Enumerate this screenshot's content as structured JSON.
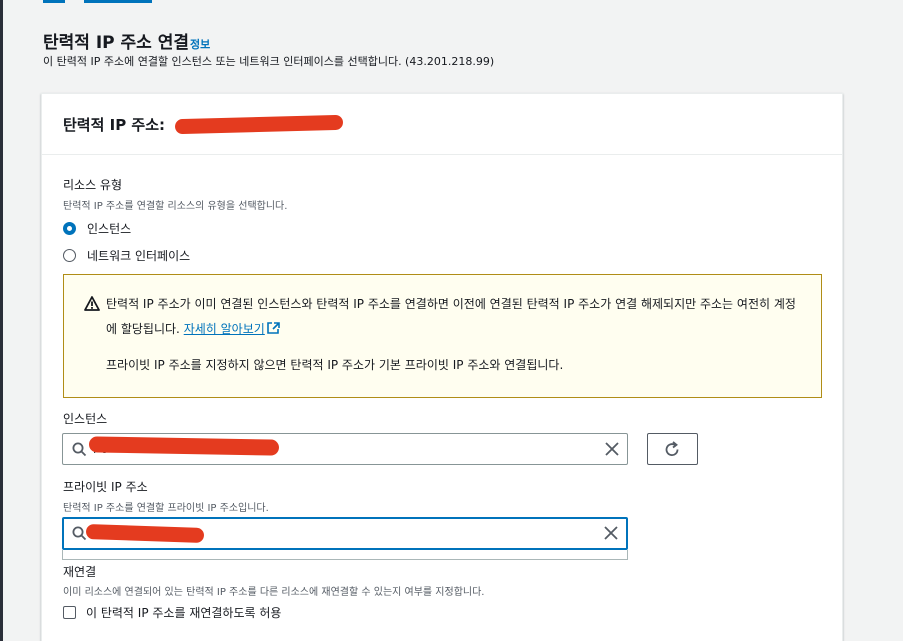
{
  "page": {
    "title": "탄력적 IP 주소 연결",
    "info_link": "정보",
    "description": "이 탄력적 IP 주소에 연결할 인스턴스 또는 네트워크 인터페이스를 선택합니다. (43.201.218.99)"
  },
  "card": {
    "header_title": "탄력적 IP 주소:"
  },
  "resource_type": {
    "label": "리소스 유형",
    "description": "탄력적 IP 주소를 연결할 리소스의 유형을 선택합니다.",
    "options": [
      {
        "label": "인스턴스",
        "checked": true
      },
      {
        "label": "네트워크 인터페이스",
        "checked": false
      }
    ]
  },
  "alert": {
    "text_line1": "탄력적 IP 주소가 이미 연결된 인스턴스와 탄력적 IP 주소를 연결하면 이전에 연결된 탄력적 IP 주소가 연결 해제되지만 주소는 여전히 계정에 할당됩니다.",
    "link": "자세히 알아보기",
    "text_line2": "프라이빗 IP 주소를 지정하지 않으면 탄력적 IP 주소가 기본 프라이빗 IP 주소와 연결됩니다."
  },
  "instance": {
    "label": "인스턴스",
    "value": "i-0"
  },
  "private_ip": {
    "label": "프라이빗 IP 주소",
    "description": "탄력적 IP 주소를 연결할 프라이빗 IP 주소입니다.",
    "value": ""
  },
  "reassociation": {
    "label": "재연결",
    "description": "이미 리소스에 연결되어 있는 탄력적 IP 주소를 다른 리소스에 재연결할 수 있는지 여부를 지정합니다.",
    "checkbox_label": "이 탄력적 IP 주소를 재연결하도록 허용",
    "checked": false
  },
  "colors": {
    "accent": "#0073bb",
    "warning_border": "#b08d16",
    "warning_bg": "#fffef0",
    "redaction": "#e43b1f"
  }
}
